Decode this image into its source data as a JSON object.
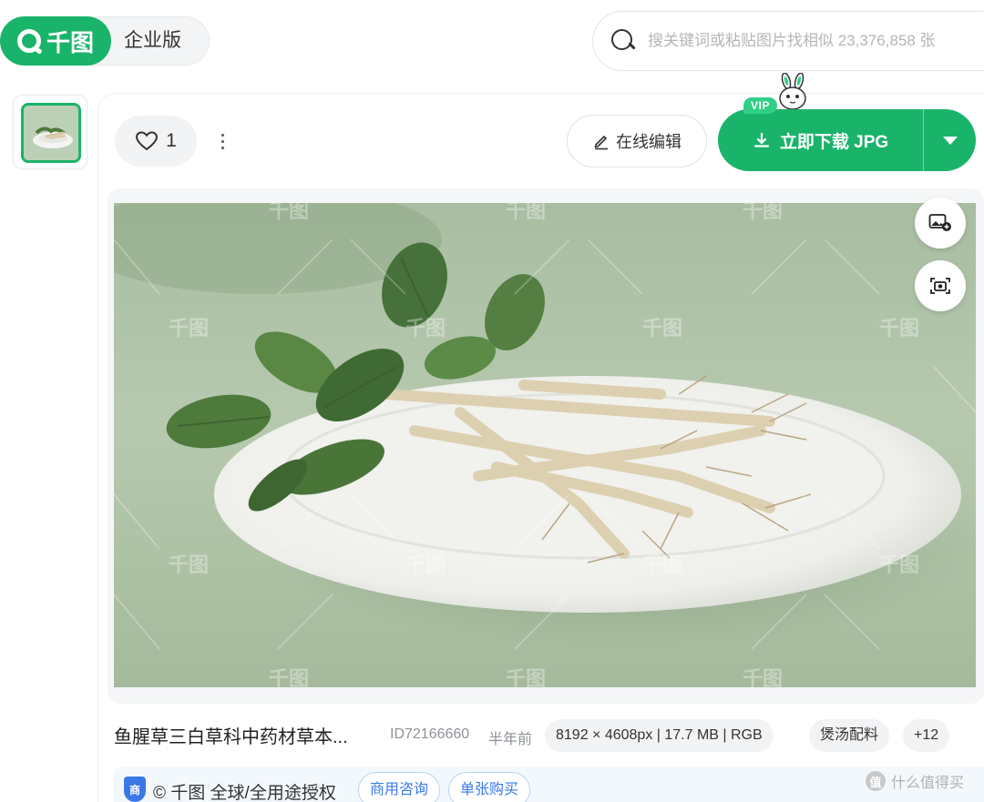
{
  "header": {
    "logo_text": "千图",
    "enterprise_label": "企业版",
    "search": {
      "placeholder": "搜关键词或粘贴图片找相似 23,376,858 张"
    }
  },
  "toolbar": {
    "like_count": "1",
    "edit_label": "在线编辑",
    "download_label": "立即下载 JPG",
    "vip_badge": "VIP"
  },
  "image": {
    "watermark_text": "千图",
    "title": "鱼腥草三白草科中药材草本...",
    "id": "ID72166660",
    "time": "半年前",
    "spec": "8192 × 4608px | 17.7 MB | RGB",
    "tags": [
      "煲汤配料",
      "+12"
    ]
  },
  "license": {
    "shield_label": "商",
    "text": "© 千图 全球/全用途授权",
    "consult_label": "商用咨询",
    "buy_label": "单张购买"
  },
  "corner_watermark": {
    "icon_label": "值",
    "text": "什么值得买"
  },
  "colors": {
    "brand_green": "#1ab36a",
    "license_blue": "#3b78e7"
  }
}
